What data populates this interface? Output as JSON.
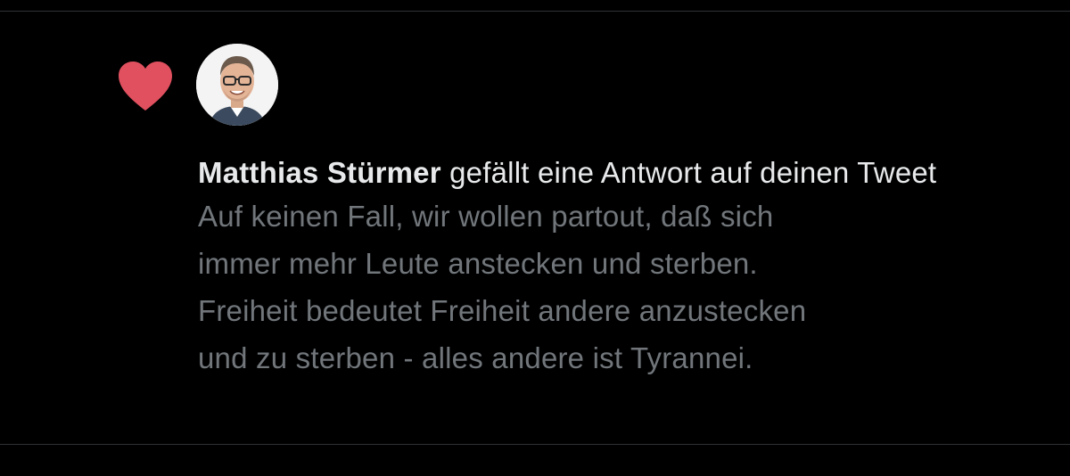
{
  "notification": {
    "type_icon": "heart-icon",
    "avatar_icon": "user-avatar",
    "user_name": "Matthias Stürmer",
    "action_text": " gefällt eine Antwort auf deinen Tweet",
    "reply_text": "Auf keinen Fall, wir wollen partout, daß sich\nimmer mehr Leute anstecken und sterben.\nFreiheit bedeutet Freiheit andere anzustecken\nund zu sterben - alles andere ist Tyrannei."
  },
  "colors": {
    "background": "#000000",
    "heart": "#e0505f",
    "primary_text": "#e7e9ea",
    "secondary_text": "#71767b",
    "divider": "#2f3336"
  }
}
